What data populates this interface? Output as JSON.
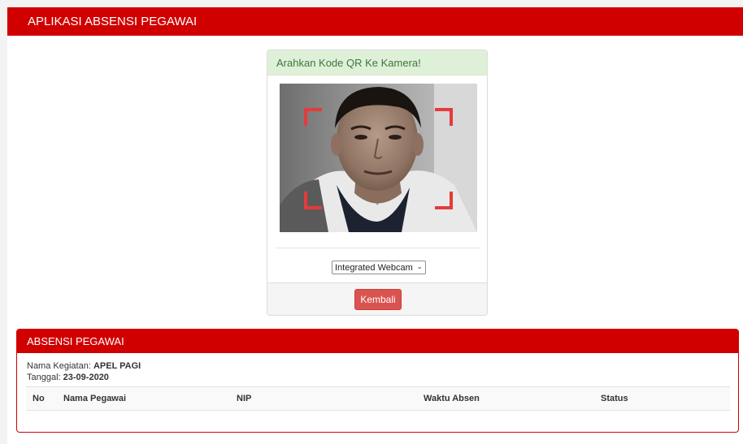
{
  "app": {
    "title": "APLIKASI ABSENSI PEGAWAI"
  },
  "scanner": {
    "heading": "Arahkan Kode QR Ke Kamera!",
    "camera_option": "Integrated Webcam",
    "back_button": "Kembali"
  },
  "attendance": {
    "heading": "ABSENSI PEGAWAI",
    "activity_label": "Nama Kegiatan:",
    "activity_value": "APEL PAGI",
    "date_label": "Tanggal:",
    "date_value": "23-09-2020",
    "columns": [
      "No",
      "Nama Pegawai",
      "NIP",
      "Waktu Absen",
      "Status"
    ],
    "rows": []
  },
  "colors": {
    "brand_red": "#d10000",
    "success_bg": "#dff0d8",
    "success_text": "#3c763d",
    "danger_button": "#d9534f"
  },
  "icons": {
    "select_chevron": "chevron-down-icon"
  }
}
